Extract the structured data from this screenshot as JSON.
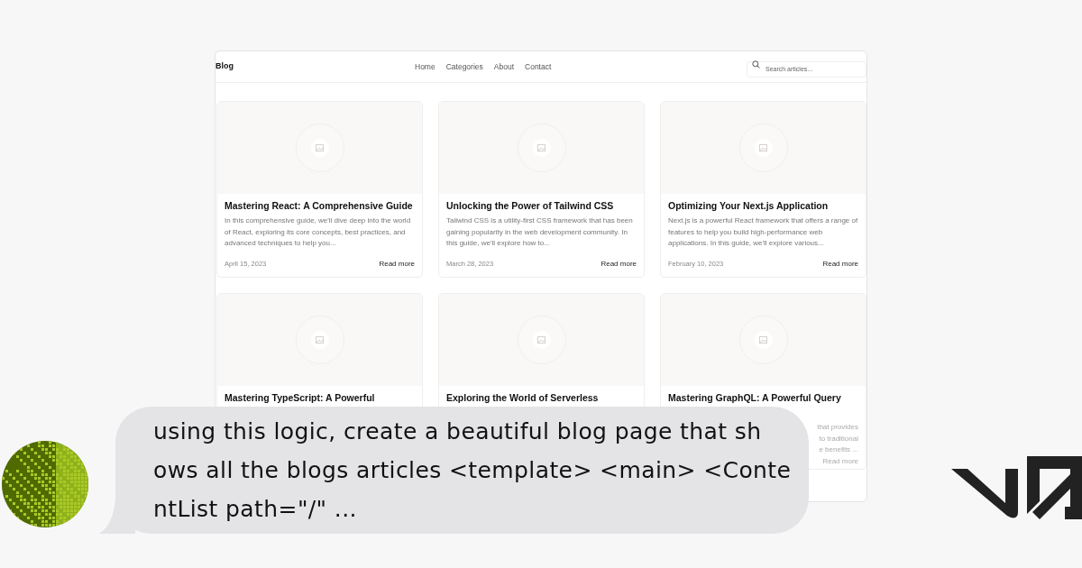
{
  "header": {
    "brand": "Blog",
    "nav": [
      "Home",
      "Categories",
      "About",
      "Contact"
    ],
    "search": {
      "placeholder": "Search articles..."
    }
  },
  "posts": [
    {
      "title": "Mastering React: A Comprehensive Guide",
      "description": "In this comprehensive guide, we'll dive deep into the world of React, exploring its core concepts, best practices, and advanced techniques to help you...",
      "date": "April 15, 2023",
      "link": "Read more"
    },
    {
      "title": "Unlocking the Power of Tailwind CSS",
      "description": "Tailwind CSS is a utility-first CSS framework that has been gaining popularity in the web development community. In this guide, we'll explore how to...",
      "date": "March 28, 2023",
      "link": "Read more"
    },
    {
      "title": "Optimizing Your Next.js Application",
      "description": "Next.js is a powerful React framework that offers a range of features to help you build high-performance web applications. In this guide, we'll explore various...",
      "date": "February 10, 2023",
      "link": "Read more"
    },
    {
      "title": "Mastering TypeScript: A Powerful"
    },
    {
      "title": "Exploring the World of Serverless"
    },
    {
      "title": "Mastering GraphQL: A Powerful Query",
      "description_fragments": [
        "that provides",
        "to traditional",
        "e benefits ..."
      ],
      "link": "Read more"
    }
  ],
  "message": {
    "lines": [
      "using this logic, create a beautiful blog page that sh",
      "ows all the blogs articles <template> <main> <Conte",
      "ntList path=\"/\" ..."
    ]
  }
}
